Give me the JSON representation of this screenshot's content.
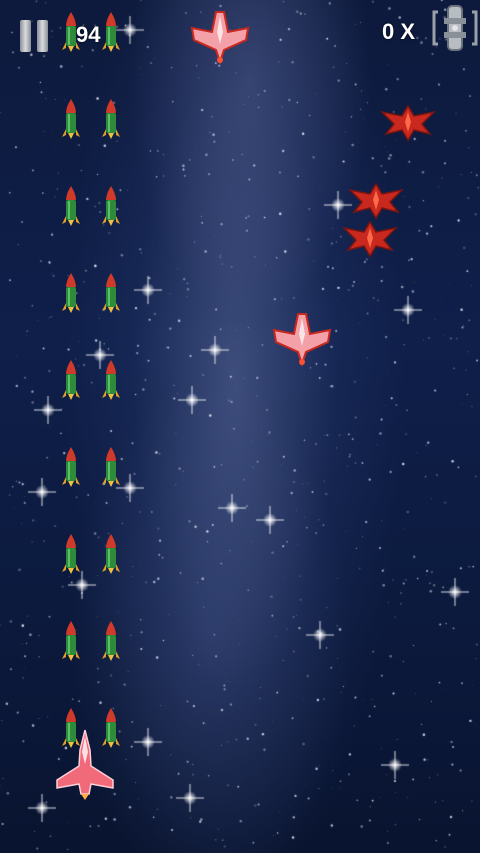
{
  "hud": {
    "score": "94",
    "multiplier": "0 X",
    "pause_icon": "pause-icon",
    "powerup_icon": "ship-powerup-icon"
  },
  "colors": {
    "sky": "#0d1a3d",
    "missile_body": "#2e8b3a",
    "missile_tip": "#d03a2a",
    "enemy_red": "#c8281e",
    "jet_pink": "#f06a7a"
  },
  "sprites": {
    "missile": "missile-icon",
    "enemy_jet": "enemy-jet-icon",
    "enemy_fighter": "enemy-fighter-icon",
    "player_ship": "player-ship-icon"
  }
}
